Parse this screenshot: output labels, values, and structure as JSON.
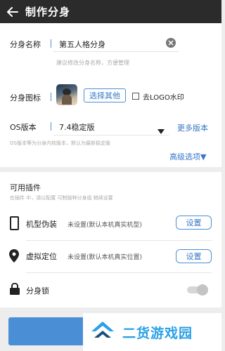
{
  "header": {
    "title": "制作分身"
  },
  "clone_name": {
    "label": "分身名称",
    "value": "第五人格分身",
    "hint": "建议修改分身名称，方便管理"
  },
  "clone_icon": {
    "label": "分身图标",
    "choose_button": "选择其他",
    "remove_logo_label": "去LOGO水印"
  },
  "os_version": {
    "label": "OS版本",
    "value": "7.4稳定版",
    "more_link": "更多版本",
    "hint": "OS版本等为分身内核版本，默认为最新稳定版"
  },
  "advanced": {
    "label": "高级选项▼"
  },
  "plugins": {
    "title": "可用插件",
    "hint": "在插件 中，请以配置 可制版种分身组 稍续设置",
    "device_spoof": {
      "label": "机型伪装",
      "status": "未设置(默认本机真实机型)",
      "button": "设置"
    },
    "virtual_location": {
      "label": "虚拟定位",
      "status": "未设置(默认本机真实位置)",
      "button": "设置"
    },
    "clone_lock": {
      "label": "分身锁"
    }
  },
  "watermark": {
    "text": "二货游戏园"
  },
  "colors": {
    "accent": "#4a8fd6",
    "header_bg": "#2b2b2b",
    "watermark": "#2aa0e6"
  }
}
